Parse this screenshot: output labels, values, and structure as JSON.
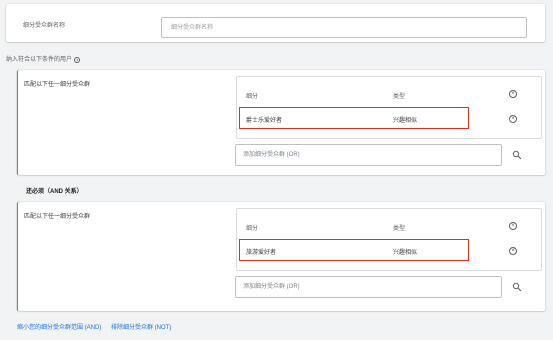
{
  "segment_name": {
    "label": "细分受众群名称",
    "placeholder": "细分受众群名称"
  },
  "include_label": "纳入符合以下条件的用户",
  "groups": [
    {
      "title": "匹配以下任一细分受众群",
      "header_segment": "细分",
      "header_type": "类型",
      "row": {
        "segment": "爵士乐爱好者",
        "type": "兴趣相似"
      },
      "add_placeholder": "添加细分受众群 (OR)"
    },
    {
      "title": "匹配以下任一细分受众群",
      "header_segment": "细分",
      "header_type": "类型",
      "row": {
        "segment": "旅游爱好者",
        "type": "兴趣相似"
      },
      "add_placeholder": "添加细分受众群 (OR)"
    }
  ],
  "and_label": "还必须（AND 关系）",
  "footer": {
    "narrow_link": "缩小您的细分受众群范围 (AND)",
    "exclude_link": "排除细分受众群 (NOT)"
  },
  "colors": {
    "accent": "#1a73e8",
    "highlight": "#d93025",
    "group_border": "#34a853"
  }
}
